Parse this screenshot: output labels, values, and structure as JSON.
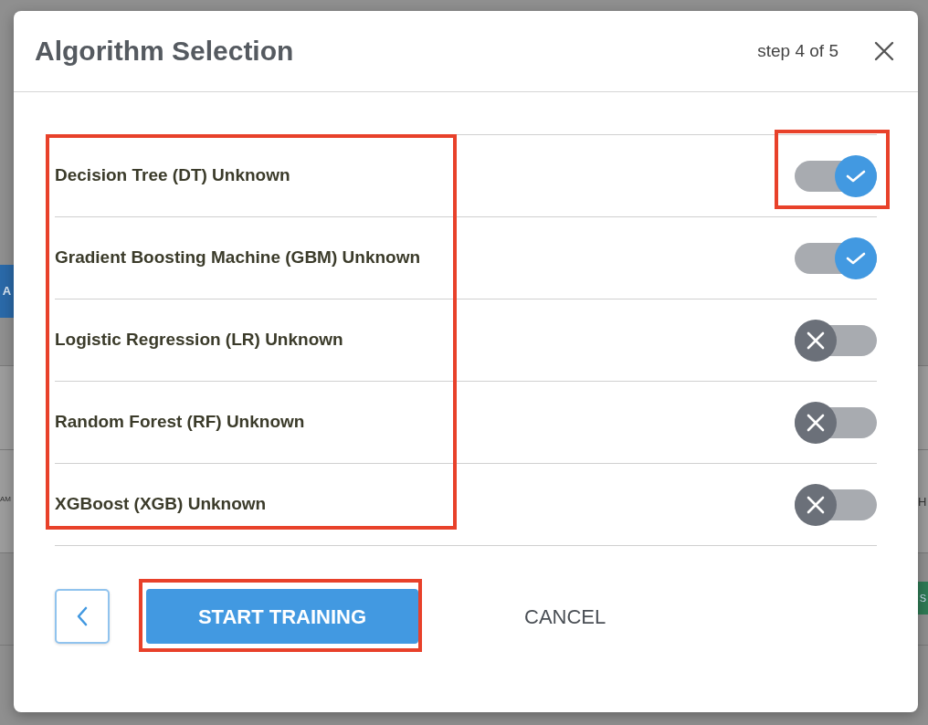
{
  "background": {
    "left_button": "A",
    "left_text": "AM",
    "right_text": "H",
    "right_badge": "S"
  },
  "modal": {
    "title": "Algorithm Selection",
    "step": "step 4 of 5"
  },
  "algorithms": [
    {
      "name": "Decision Tree (DT) Unknown",
      "on": true
    },
    {
      "name": "Gradient Boosting Machine (GBM) Unknown",
      "on": true
    },
    {
      "name": "Logistic Regression (LR) Unknown",
      "on": false
    },
    {
      "name": "Random Forest (RF) Unknown",
      "on": false
    },
    {
      "name": "XGBoost (XGB) Unknown",
      "on": false
    }
  ],
  "buttons": {
    "primary": "START TRAINING",
    "secondary": "CANCEL"
  },
  "highlights": [
    {
      "kind": "labels"
    },
    {
      "kind": "first-toggle"
    },
    {
      "kind": "primary-button"
    }
  ]
}
